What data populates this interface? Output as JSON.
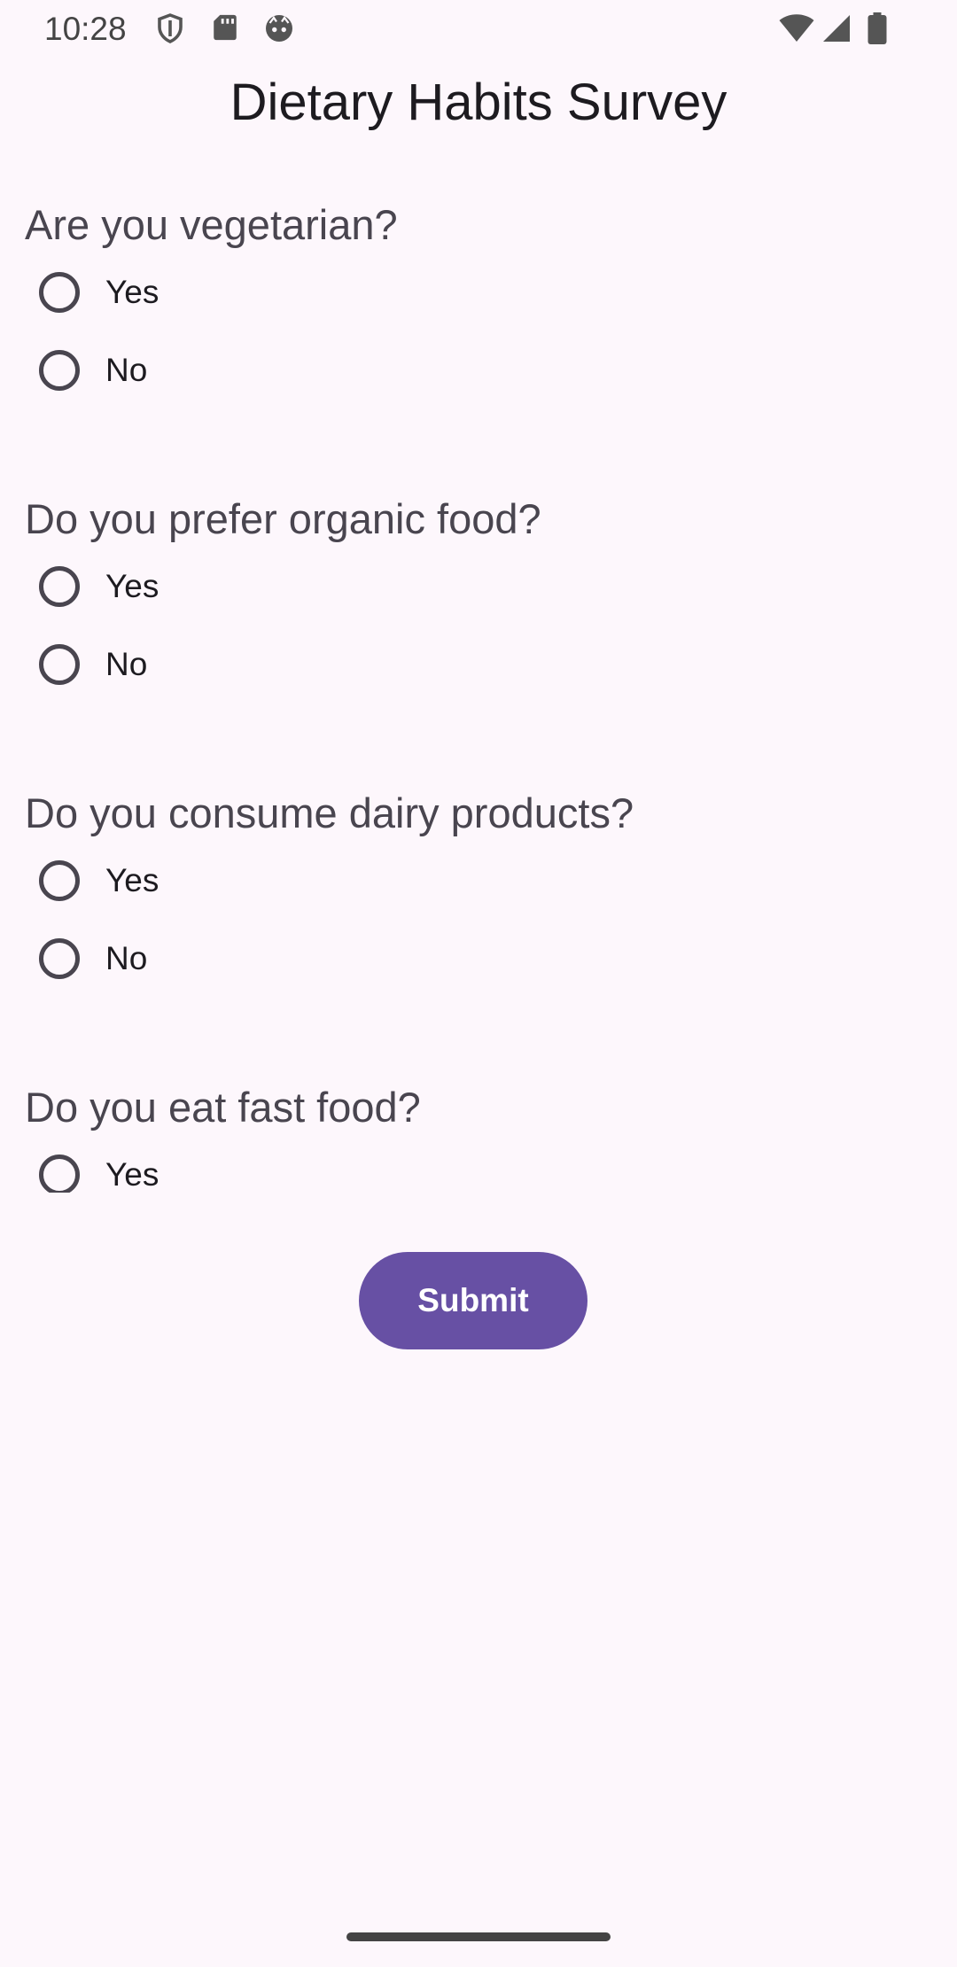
{
  "status_bar": {
    "time": "10:28",
    "icons": [
      "shield-icon",
      "sd-card-icon",
      "face-icon",
      "wifi-icon",
      "signal-icon",
      "battery-icon"
    ]
  },
  "title": "Dietary Habits Survey",
  "questions": [
    {
      "text": "Are you vegetarian?",
      "options": [
        "Yes",
        "No"
      ]
    },
    {
      "text": "Do you prefer organic food?",
      "options": [
        "Yes",
        "No"
      ]
    },
    {
      "text": "Do you consume dairy products?",
      "options": [
        "Yes",
        "No"
      ]
    },
    {
      "text": "Do you eat fast food?",
      "options": [
        "Yes"
      ]
    }
  ],
  "submit_label": "Submit",
  "colors": {
    "background": "#FDF7FC",
    "accent": "#6750A4",
    "radio_outline": "#49454F"
  }
}
